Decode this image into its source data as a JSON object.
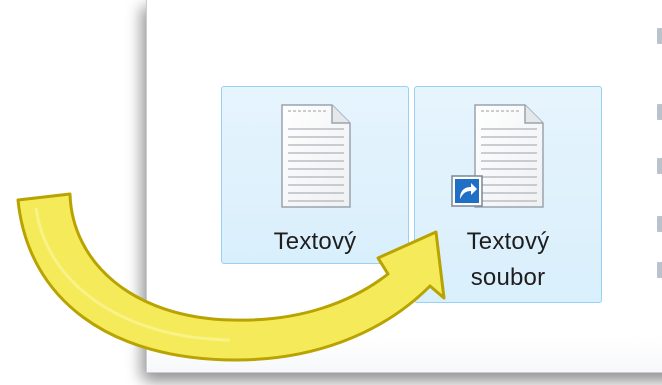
{
  "files": [
    {
      "name": "Textový",
      "icon": "text-document-icon"
    },
    {
      "name_line1": "Textový",
      "name_line2": "soubor",
      "icon": "text-document-icon",
      "badge_icon": "shortcut-arrow-icon"
    }
  ],
  "annotation": {
    "icon": "curved-arrow-icon",
    "color": "#f5ea5a"
  },
  "colors": {
    "selection_fill": "#d9effc",
    "selection_border": "#99d1f4"
  }
}
